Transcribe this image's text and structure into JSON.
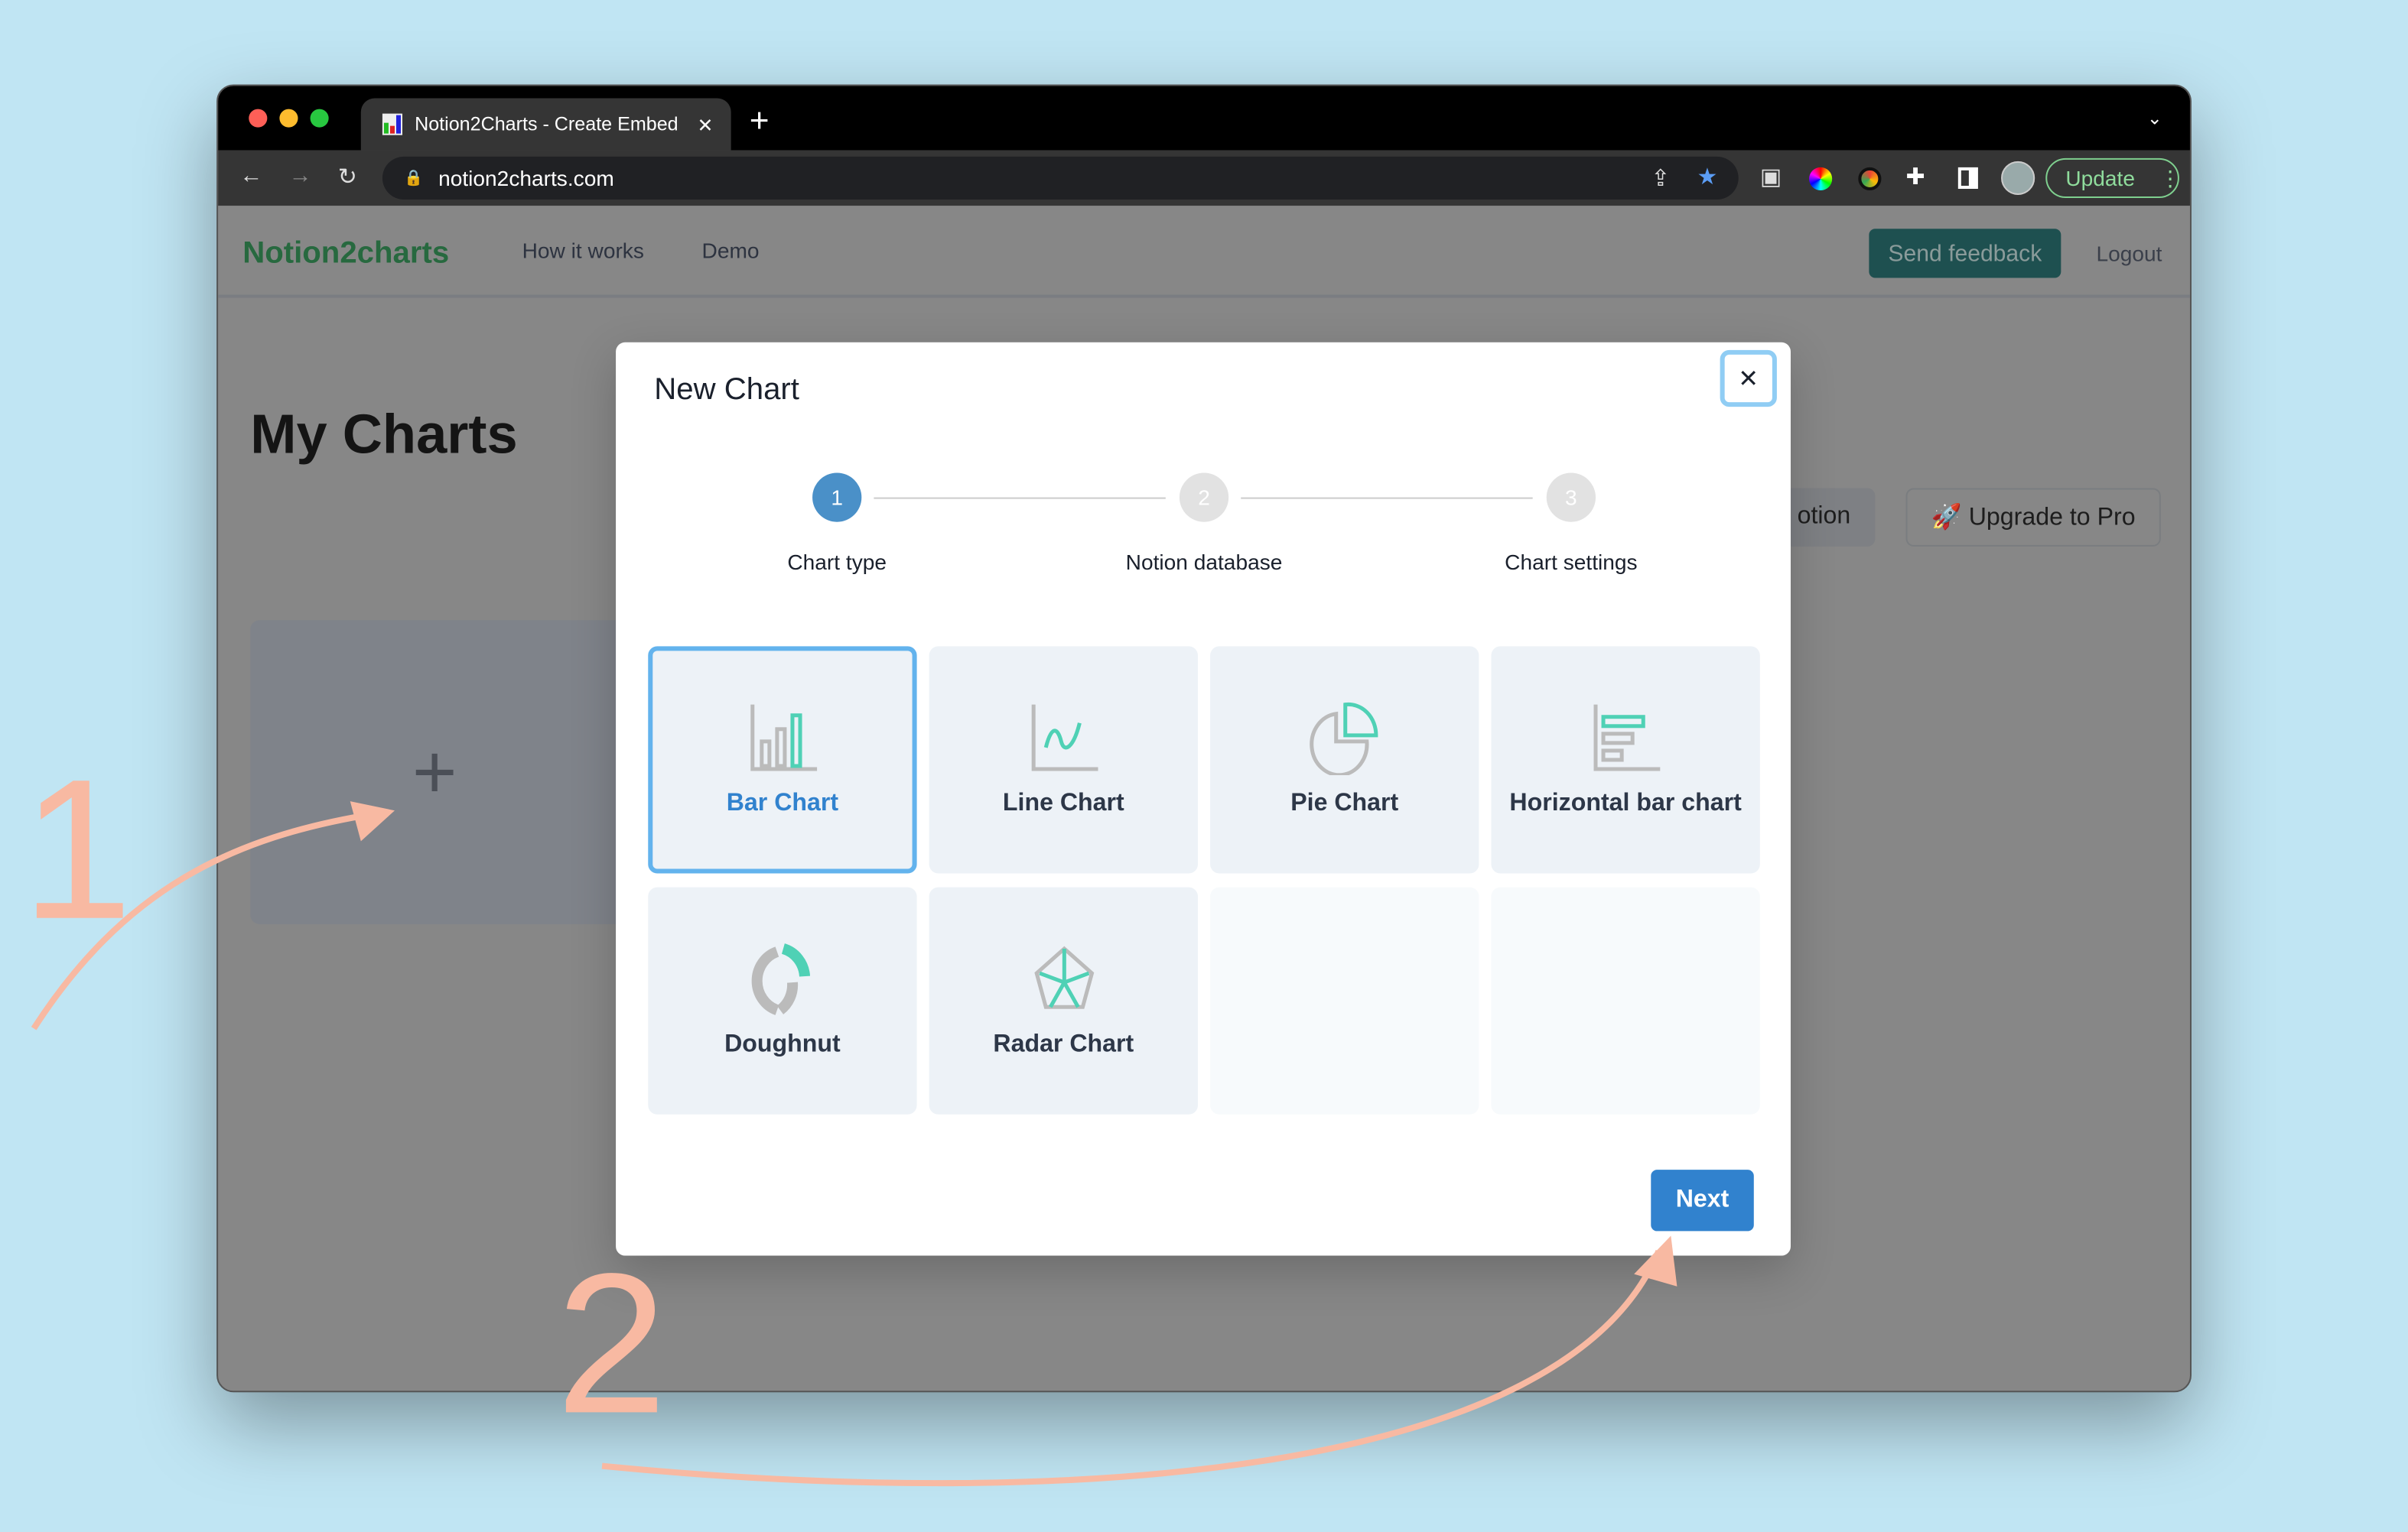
{
  "browser": {
    "tab_title": "Notion2Charts - Create Embed",
    "url": "notion2charts.com",
    "update_label": "Update"
  },
  "nav": {
    "logo": "Notion2charts",
    "links": [
      "How it works",
      "Demo"
    ],
    "send_feedback": "Send feedback",
    "logout": "Logout"
  },
  "main": {
    "title": "My Charts",
    "connect_label": "otion",
    "upgrade_label": "🚀 Upgrade to Pro",
    "add_symbol": "+"
  },
  "modal": {
    "title": "New Chart",
    "close_symbol": "✕",
    "steps": [
      {
        "num": "1",
        "label": "Chart type",
        "active": true
      },
      {
        "num": "2",
        "label": "Notion database",
        "active": false
      },
      {
        "num": "3",
        "label": "Chart settings",
        "active": false
      }
    ],
    "chart_types": [
      {
        "label": "Bar Chart",
        "icon": "bar-chart-icon",
        "selected": true
      },
      {
        "label": "Line Chart",
        "icon": "line-chart-icon"
      },
      {
        "label": "Pie Chart",
        "icon": "pie-chart-icon"
      },
      {
        "label": "Horizontal bar chart",
        "icon": "horizontal-bar-chart-icon"
      },
      {
        "label": "Doughnut",
        "icon": "doughnut-chart-icon"
      },
      {
        "label": "Radar Chart",
        "icon": "radar-chart-icon"
      }
    ],
    "next_label": "Next"
  },
  "annotations": [
    "1",
    "2"
  ],
  "colors": {
    "accent": "#3182ce",
    "selected_border": "#63b3ed",
    "icon_green": "#4fd1b5",
    "annotation": "#f8b9a2",
    "feedback": "#1e5050"
  }
}
